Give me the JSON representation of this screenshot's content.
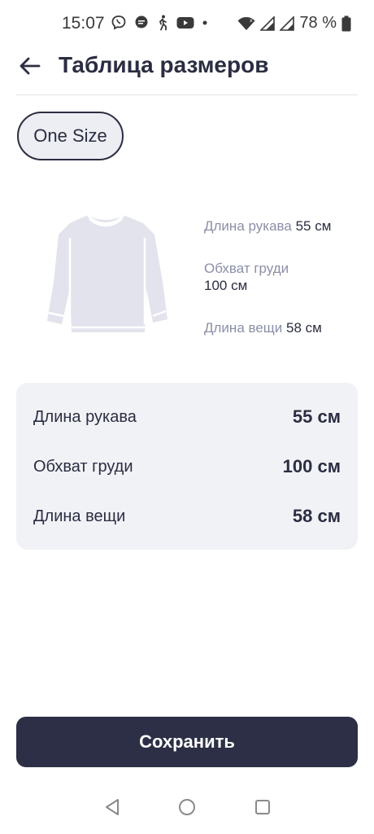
{
  "status_bar": {
    "time": "15:07",
    "battery": "78 %",
    "icons": [
      "viber-icon",
      "message-bubble-icon",
      "walking-icon",
      "youtube-icon",
      "dot-icon",
      "wifi-icon",
      "signal-icon",
      "signal-icon",
      "battery-icon"
    ]
  },
  "header": {
    "title": "Таблица размеров",
    "back_icon": "arrow-left-icon"
  },
  "size_chip": {
    "label": "One Size"
  },
  "illustration": {
    "icon": "sweater-icon",
    "measurements": [
      {
        "label": "Длина рукава",
        "value": "55 см"
      },
      {
        "label": "Обхват груди",
        "value": "100 см"
      },
      {
        "label": "Длина вещи",
        "value": "58 см"
      }
    ]
  },
  "table": {
    "rows": [
      {
        "label": "Длина рукава",
        "value": "55 см"
      },
      {
        "label": "Обхват груди",
        "value": "100 см"
      },
      {
        "label": "Длина вещи",
        "value": "58 см"
      }
    ]
  },
  "save_button": {
    "label": "Сохранить"
  },
  "nav_bar": {
    "icons": [
      "nav-back-icon",
      "nav-home-icon",
      "nav-recent-icon"
    ]
  },
  "colors": {
    "primary": "#2c2f45",
    "muted_text": "#8b8fa6",
    "card_bg": "#f1f2f6",
    "chip_bg": "#eceef3"
  }
}
